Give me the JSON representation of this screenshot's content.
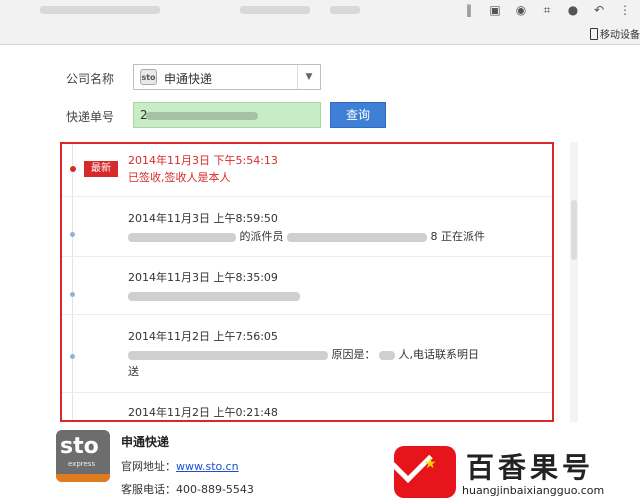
{
  "browser": {
    "mobile_link": "移动设备"
  },
  "form": {
    "company_label": "公司名称",
    "company_value": "申通快递",
    "company_logo_text": "sto",
    "tracking_label": "快递单号",
    "tracking_value": "2",
    "query_button": "查询"
  },
  "tracking": {
    "latest_badge": "最新",
    "entries": [
      {
        "time": "2014年11月3日 下午5:54:13",
        "text": "已签收,签收人是本人"
      },
      {
        "time": "2014年11月3日 上午8:59:50",
        "text_visible": "的派件员",
        "text_tail": "8 正在派件"
      },
      {
        "time": "2014年11月3日 上午8:35:09"
      },
      {
        "time": "2014年11月2日 上午7:56:05",
        "text_visible": "原因是：",
        "text_mid": "人,电话联系明日",
        "text_line2": "送"
      },
      {
        "time": "2014年11月2日 上午0:21:48"
      }
    ]
  },
  "company_info": {
    "logo_text": "sto",
    "logo_sub": "express",
    "name": "申通快递",
    "website_label": "官网地址：",
    "website_value": "www.sto.cn",
    "phone_label": "客服电话：",
    "phone_value": "400-889-5543"
  },
  "watermark": {
    "title": "百香果号",
    "url": "huangjinbaixiangguo.com"
  }
}
